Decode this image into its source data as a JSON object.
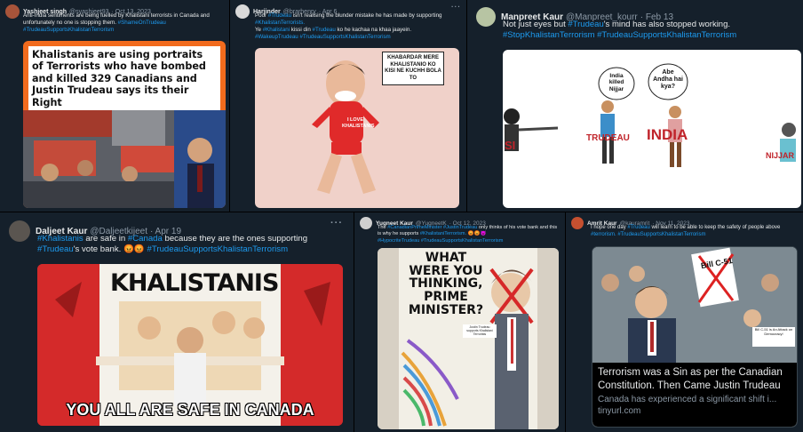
{
  "tweets": [
    {
      "author": "Yashjeet singh",
      "handle": "@syashjeet93",
      "date": "· Oct 13, 2023",
      "text": "Anti-India sentiments are being fuelled by Khalistani terrorists in Canada and unfortunately no one is stopping them.",
      "tags": "#ShameOnTrudeau #TrudeauSupportsKhalistanTerrorism",
      "media_text": "Khalistanis are using portraits of Terrorists who have bombed and killed 329 Canadians and Justin Trudeau says its their Right"
    },
    {
      "author": "Harjinder",
      "handle": "@brarhenry",
      "date": "· Apr 6",
      "text_a": "Poor",
      "tag_a": "#Trudeau",
      "text_b": "isn't realising the blunder mistake he has made by supporting",
      "tag_b": "#KhalistanTerrorists.",
      "text_c": "Ye",
      "tag_c": "#Khalistani",
      "text_d": "kissi din",
      "tag_d": "#Trudeau",
      "text_e": "ko he kachaa na khaa jaayein.",
      "tags": "#WakeupTrudeau #TrudeauSupportsKhalistanTerrorism",
      "bubble": "KHABARDAR MERE KHALISTANIO KO KISI NE KUCHH BOLA TO",
      "shirt": "I LOVE KHALISTANIS"
    },
    {
      "author": "Manpreet Kaur",
      "handle": "@Manpreet_kourr",
      "date": "· Feb 13",
      "text_a": "Not just eyes but",
      "tag_a": "#Trudeau",
      "text_b": "'s mind has also stopped working.",
      "tags": "#StopKhalistanTerrorism #TrudeauSupportsKhalistanTerrorism",
      "bubble_1": "India killed Nijjar",
      "bubble_2": "Abe Andha hai kya?",
      "label_si": "SI",
      "label_trudeau": "TRUDEAU",
      "label_india": "INDIA",
      "label_nijjar": "NIJJAR"
    },
    {
      "author": "Daljeet Kaur",
      "handle": "@Daljeetkijeet",
      "date": "· Apr 19",
      "tag_a": "#Khalistanis",
      "text_a": "are safe in",
      "tag_b": "#Canada",
      "text_b": "because they are the ones supporting",
      "tag_c": "#Trudeau",
      "text_c": "'s vote bank.",
      "emoji": "😡😡",
      "tags": "#TrudeauSupportsKhalistanTerrorism",
      "banner": "KHALISTANIS",
      "caption": "YOU ALL ARE SAFE IN CANADA"
    },
    {
      "author": "Yugneet Kaur",
      "handle": "@YugneetK",
      "date": "· Oct 12, 2023",
      "text_a": "The",
      "tag_a": "#CanadianPrimeMinister #JustinTrudeau",
      "text_b": "only thinks of his vote bank and this is why he supports",
      "tag_b": "#KhalistaniTerrorism.",
      "emoji": "😡😡😈",
      "tags": "#HypocriteTrudeau #TrudeauSupportsKhalistanTerrorism",
      "cartoon_text": "WHAT WERE YOU THINKING, PRIME MINISTER?",
      "note": "Justin Trudeau supports Khalistani Terrorists"
    },
    {
      "author": "Amrit Kaur",
      "handle": "@kauramrit",
      "date": "· Nov 11, 2023",
      "text_a": "I hope one day",
      "tag_a": "#Trudeau",
      "text_b": "will learn to be able to keep the safety of people above",
      "tag_b": "#terrorism.",
      "tags": "#TrudeauSupportsKhalistanTerrorism",
      "sign_1": "Bill C-51",
      "sign_2": "Bill C-51 is An Attack on Democracy!",
      "link_title": "Terrorism was a Sin as per the Canadian Constitution. Then Came Justin Trudeau",
      "link_desc": "Canada has experienced a significant shift i...",
      "link_domain": "tinyurl.com"
    }
  ],
  "more_label": "···",
  "colors": {
    "link": "#1d9bf0",
    "bg": "#15202b",
    "muted": "#8b98a5"
  }
}
